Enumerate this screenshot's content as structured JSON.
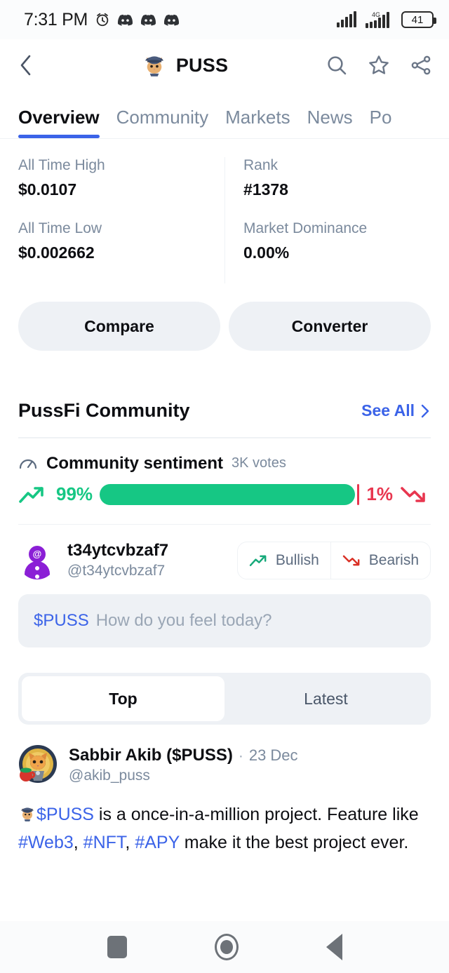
{
  "status_bar": {
    "time": "7:31 PM",
    "alarm_icon": "alarm-icon",
    "notification_icons": [
      "discord-icon",
      "discord-icon",
      "discord-icon"
    ],
    "signal_icon": "signal-bars-icon",
    "network_type": "4G",
    "battery_level": "41"
  },
  "app_bar": {
    "back_icon": "chevron-left-icon",
    "coin_logo": "puss-cat-logo",
    "title": "PUSS",
    "search_icon": "search-icon",
    "favorite_icon": "star-icon",
    "share_icon": "share-icon"
  },
  "tabs": [
    {
      "label": "Overview",
      "active": true
    },
    {
      "label": "Community",
      "active": false
    },
    {
      "label": "Markets",
      "active": false
    },
    {
      "label": "News",
      "active": false
    },
    {
      "label": "Po",
      "active": false
    }
  ],
  "stats": [
    {
      "label": "All Time High",
      "value": "$0.0107"
    },
    {
      "label": "Rank",
      "value": "#1378"
    },
    {
      "label": "All Time Low",
      "value": "$0.002662"
    },
    {
      "label": "Market Dominance",
      "value": "0.00%"
    }
  ],
  "actions": {
    "compare_label": "Compare",
    "converter_label": "Converter"
  },
  "community": {
    "section_title": "PussFi Community",
    "see_all_label": "See All",
    "see_all_chevron": "chevron-right-icon",
    "sentiment": {
      "gauge_icon": "gauge-icon",
      "title": "Community sentiment",
      "votes": "3K votes",
      "bullish_pct": "99%",
      "bearish_pct": "1%",
      "bullish_value": 99,
      "bearish_value": 1,
      "bullish_color": "#16c784",
      "bearish_color": "#e8364f",
      "trend_up_icon": "trend-up-icon",
      "trend_down_icon": "trend-down-icon"
    },
    "current_user": {
      "avatar": "cmc-default-avatar",
      "name": "t34ytcvbzaf7",
      "handle": "@t34ytcvbzaf7",
      "bullish_label": "Bullish",
      "bearish_label": "Bearish"
    },
    "composer": {
      "ticker": "$PUSS",
      "placeholder": "How do you feel today?"
    },
    "feed_tabs": [
      {
        "label": "Top",
        "active": true
      },
      {
        "label": "Latest",
        "active": false
      }
    ],
    "posts": [
      {
        "avatar": "cat-coffee-avatar",
        "author": "Sabbir Akib ($PUSS)",
        "separator": "·",
        "date": "23 Dec",
        "handle": "@akib_puss",
        "body_emoji": "puss-cat-emoji",
        "body_segments": [
          {
            "text": "$PUSS",
            "link": true
          },
          {
            "text": " is a once-in-a-million project. Feature like ",
            "link": false
          },
          {
            "text": "#Web3",
            "link": true
          },
          {
            "text": ", ",
            "link": false
          },
          {
            "text": "#NFT",
            "link": true
          },
          {
            "text": ", ",
            "link": false
          },
          {
            "text": "#APY",
            "link": true
          },
          {
            "text": " make it the best project ever.",
            "link": false
          }
        ]
      }
    ]
  },
  "nav_bar": {
    "recents_icon": "square-recents-icon",
    "home_icon": "circle-home-icon",
    "back_icon": "triangle-back-icon"
  },
  "colors": {
    "accent_blue": "#3b63e8",
    "bullish_green": "#16c784",
    "bearish_red": "#e8364f",
    "muted_text": "#7b8a9d"
  }
}
